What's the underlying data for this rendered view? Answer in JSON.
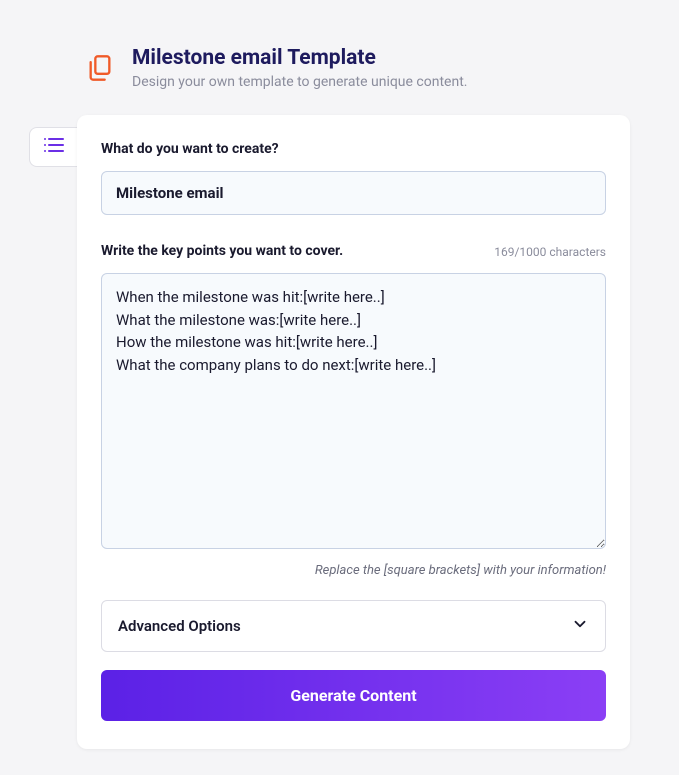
{
  "header": {
    "title": "Milestone email Template",
    "subtitle": "Design your own template to generate unique content."
  },
  "form": {
    "create_label": "What do you want to create?",
    "create_value": "Milestone email",
    "keypoints_label": "Write the key points you want to cover.",
    "char_counter": "169/1000 characters",
    "keypoints_value": "When the milestone was hit:[write here..]\nWhat the milestone was:[write here..]\nHow the milestone was hit:[write here..]\nWhat the company plans to do next:[write here..]",
    "hint": "Replace the [square brackets] with your information!",
    "advanced_label": "Advanced Options",
    "generate_label": "Generate Content"
  }
}
